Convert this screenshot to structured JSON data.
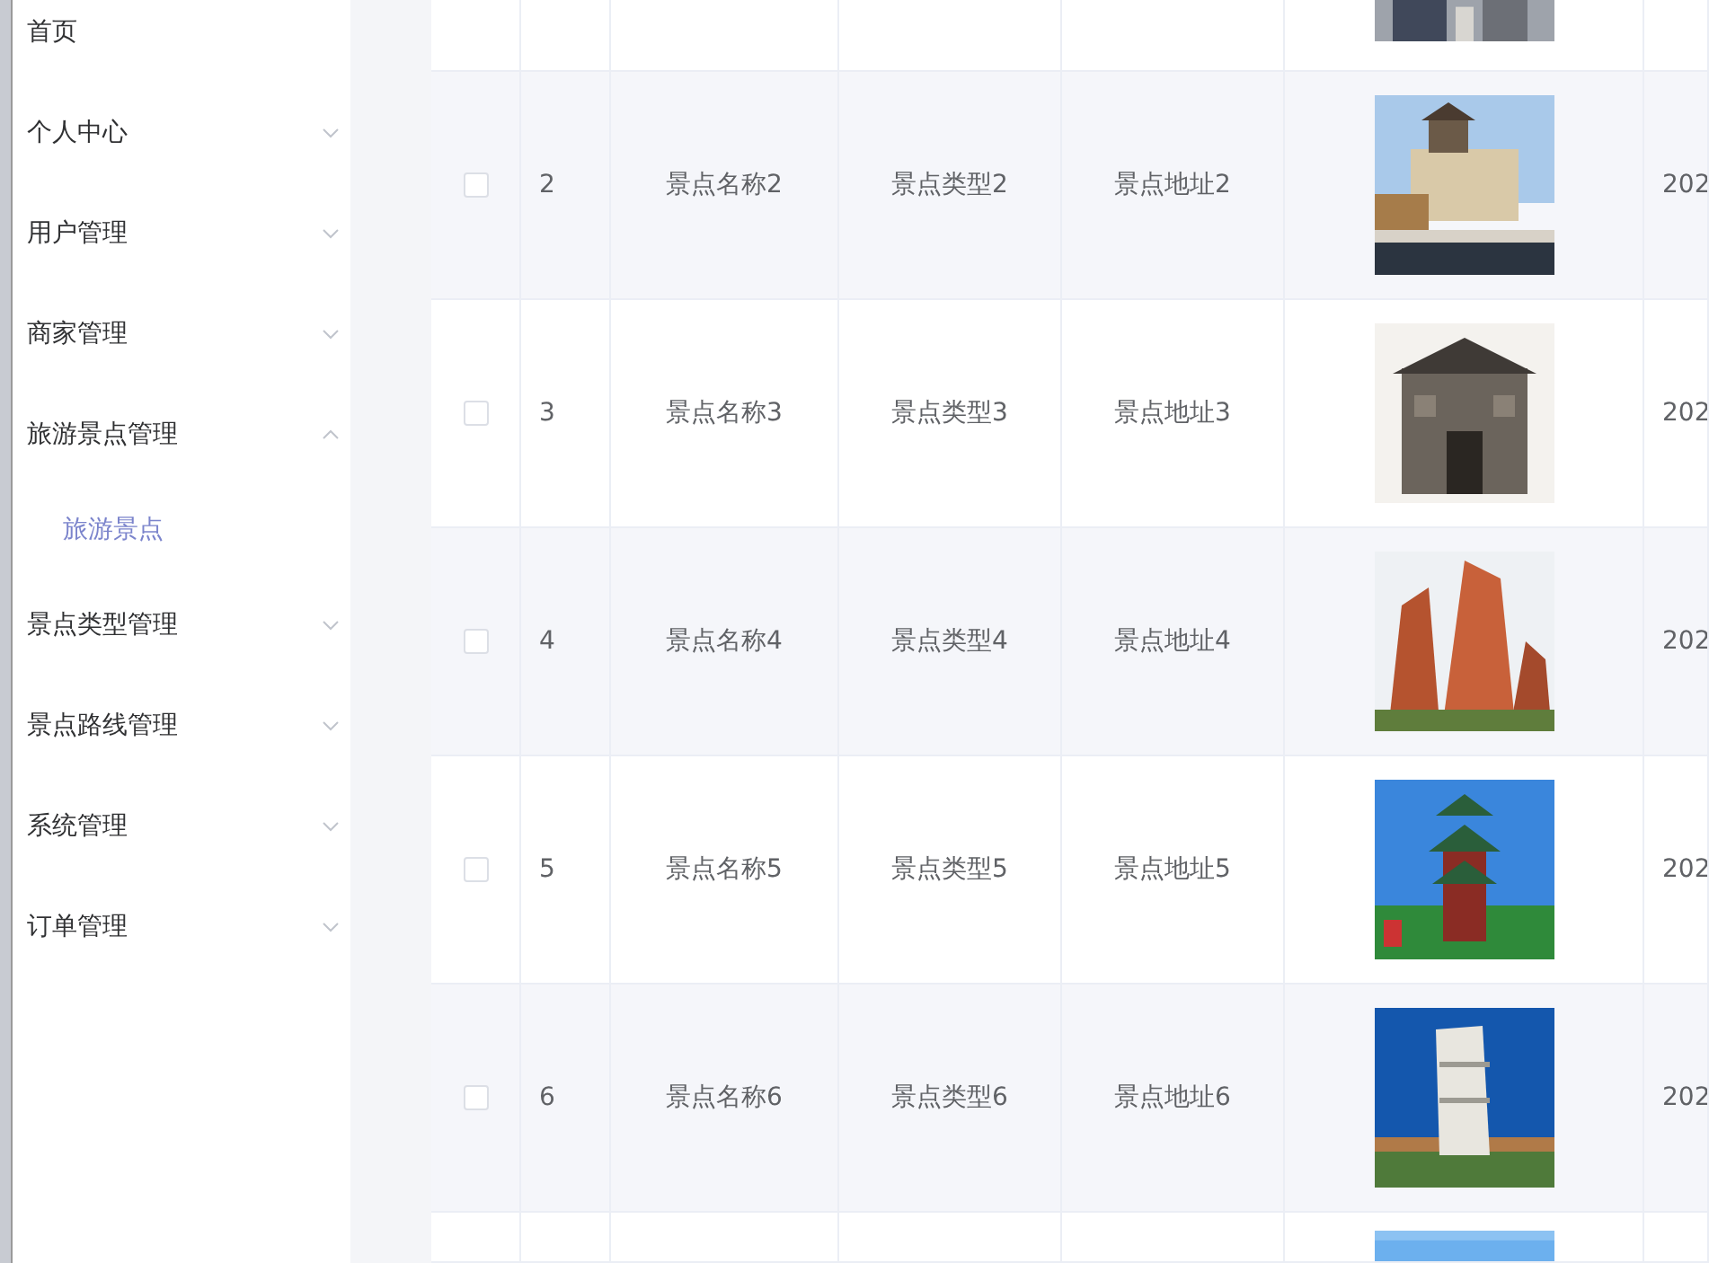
{
  "sidebar": {
    "items": [
      {
        "kind": "link",
        "label": "首页"
      },
      {
        "kind": "menu",
        "label": "个人中心",
        "expanded": false
      },
      {
        "kind": "menu",
        "label": "用户管理",
        "expanded": false
      },
      {
        "kind": "menu",
        "label": "商家管理",
        "expanded": false
      },
      {
        "kind": "menu",
        "label": "旅游景点管理",
        "expanded": true,
        "children": [
          {
            "label": "旅游景点",
            "selected": true
          }
        ]
      },
      {
        "kind": "menu",
        "label": "景点类型管理",
        "expanded": false
      },
      {
        "kind": "menu",
        "label": "景点路线管理",
        "expanded": false
      },
      {
        "kind": "menu",
        "label": "系统管理",
        "expanded": false
      },
      {
        "kind": "menu",
        "label": "订单管理",
        "expanded": false
      }
    ]
  },
  "table": {
    "rows": [
      {
        "kind": "partial-top"
      },
      {
        "kind": "full",
        "checked": false,
        "index": "2",
        "name": "景点名称2",
        "type": "景点类型2",
        "address": "景点地址2",
        "date": "202"
      },
      {
        "kind": "full",
        "checked": false,
        "index": "3",
        "name": "景点名称3",
        "type": "景点类型3",
        "address": "景点地址3",
        "date": "202"
      },
      {
        "kind": "full",
        "checked": false,
        "index": "4",
        "name": "景点名称4",
        "type": "景点类型4",
        "address": "景点地址4",
        "date": "202"
      },
      {
        "kind": "full",
        "checked": false,
        "index": "5",
        "name": "景点名称5",
        "type": "景点类型5",
        "address": "景点地址5",
        "date": "202"
      },
      {
        "kind": "full",
        "checked": false,
        "index": "6",
        "name": "景点名称6",
        "type": "景点类型6",
        "address": "景点地址6",
        "date": "202"
      },
      {
        "kind": "partial-bottom"
      }
    ]
  }
}
